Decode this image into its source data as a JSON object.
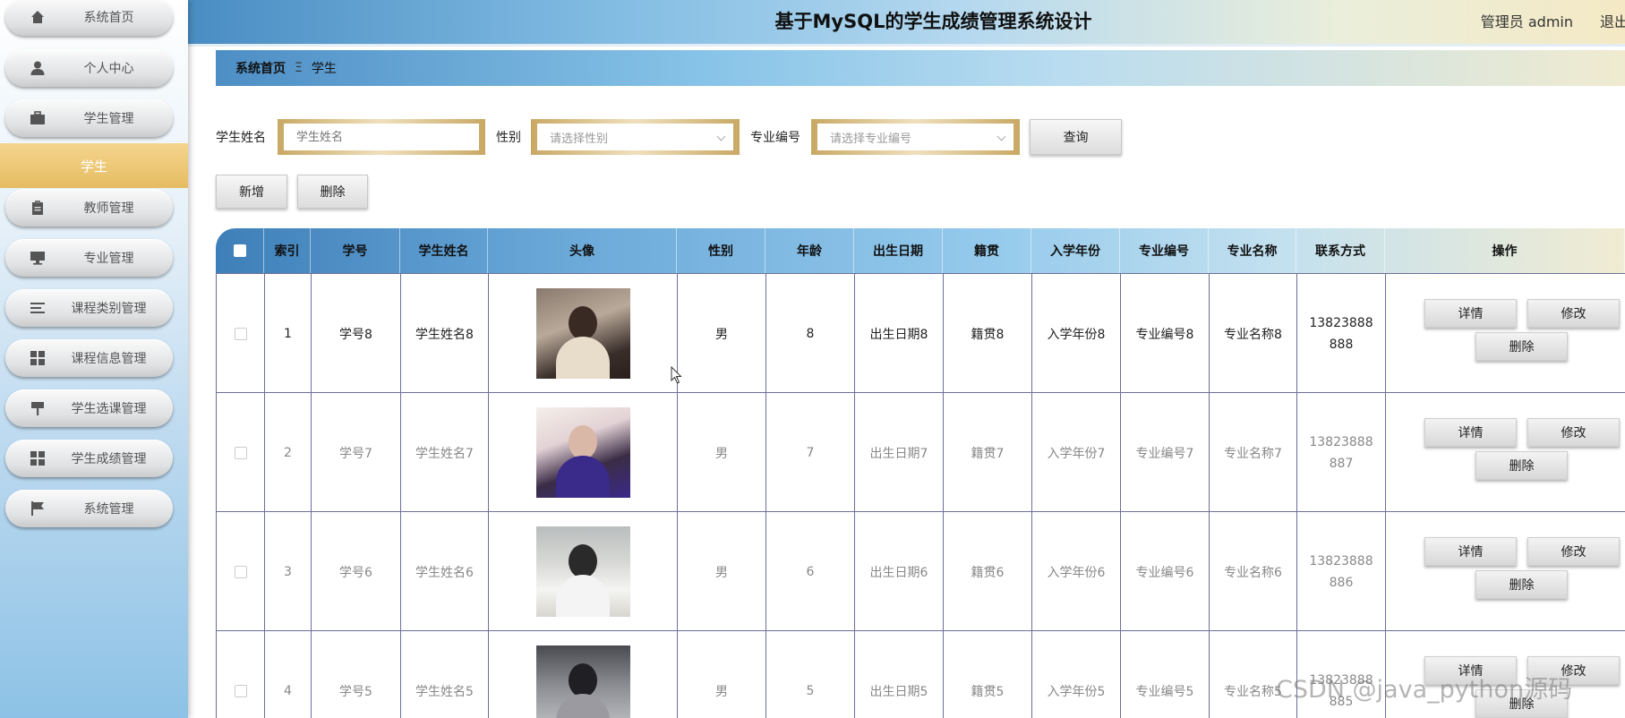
{
  "app": {
    "title": "基于MySQL的学生成绩管理系统设计",
    "user": "管理员 admin",
    "logout": "退出"
  },
  "sidebar": {
    "items": [
      {
        "label": "系统首页",
        "icon": "home-icon"
      },
      {
        "label": "个人中心",
        "icon": "user-icon"
      },
      {
        "label": "学生管理",
        "icon": "briefcase-icon"
      },
      {
        "label": "教师管理",
        "icon": "clipboard-icon"
      },
      {
        "label": "专业管理",
        "icon": "monitor-icon"
      },
      {
        "label": "课程类别管理",
        "icon": "list-icon"
      },
      {
        "label": "课程信息管理",
        "icon": "grid-icon"
      },
      {
        "label": "学生选课管理",
        "icon": "flag-pin-icon"
      },
      {
        "label": "学生成绩管理",
        "icon": "grid-icon"
      },
      {
        "label": "系统管理",
        "icon": "flag-icon"
      }
    ],
    "active_sub": "学生"
  },
  "breadcrumb": {
    "home": "系统首页",
    "separator": "Ξ",
    "current": "学生"
  },
  "search": {
    "name_label": "学生姓名",
    "name_placeholder": "学生姓名",
    "gender_label": "性别",
    "gender_placeholder": "请选择性别",
    "major_label": "专业编号",
    "major_placeholder": "请选择专业编号",
    "query_button": "查询"
  },
  "actions": {
    "add": "新增",
    "delete": "删除"
  },
  "table": {
    "headers": [
      "索引",
      "学号",
      "学生姓名",
      "头像",
      "性别",
      "年龄",
      "出生日期",
      "籍贯",
      "入学年份",
      "专业编号",
      "专业名称",
      "联系方式",
      "操作"
    ],
    "rows": [
      {
        "index": "1",
        "id": "学号8",
        "name": "学生姓名8",
        "gender": "男",
        "age": "8",
        "birth": "出生日期8",
        "origin": "籍贯8",
        "year": "入学年份8",
        "major_no": "专业编号8",
        "major_name": "专业名称8",
        "phone_1": "13823888",
        "phone_2": "888"
      },
      {
        "index": "2",
        "id": "学号7",
        "name": "学生姓名7",
        "gender": "男",
        "age": "7",
        "birth": "出生日期7",
        "origin": "籍贯7",
        "year": "入学年份7",
        "major_no": "专业编号7",
        "major_name": "专业名称7",
        "phone_1": "13823888",
        "phone_2": "887"
      },
      {
        "index": "3",
        "id": "学号6",
        "name": "学生姓名6",
        "gender": "男",
        "age": "6",
        "birth": "出生日期6",
        "origin": "籍贯6",
        "year": "入学年份6",
        "major_no": "专业编号6",
        "major_name": "专业名称6",
        "phone_1": "13823888",
        "phone_2": "886"
      },
      {
        "index": "4",
        "id": "学号5",
        "name": "学生姓名5",
        "gender": "男",
        "age": "5",
        "birth": "出生日期5",
        "origin": "籍贯5",
        "year": "入学年份5",
        "major_no": "专业编号5",
        "major_name": "专业名称5",
        "phone_1": "13823888",
        "phone_2": "885"
      }
    ],
    "ops": {
      "detail": "详情",
      "edit": "修改",
      "delete": "删除"
    }
  },
  "watermark": "CSDN @java_python源码",
  "colors": {
    "accent_gold": "#e6bc62",
    "header_blue": "#4a8dc3",
    "grid_line": "#6c6f98"
  }
}
